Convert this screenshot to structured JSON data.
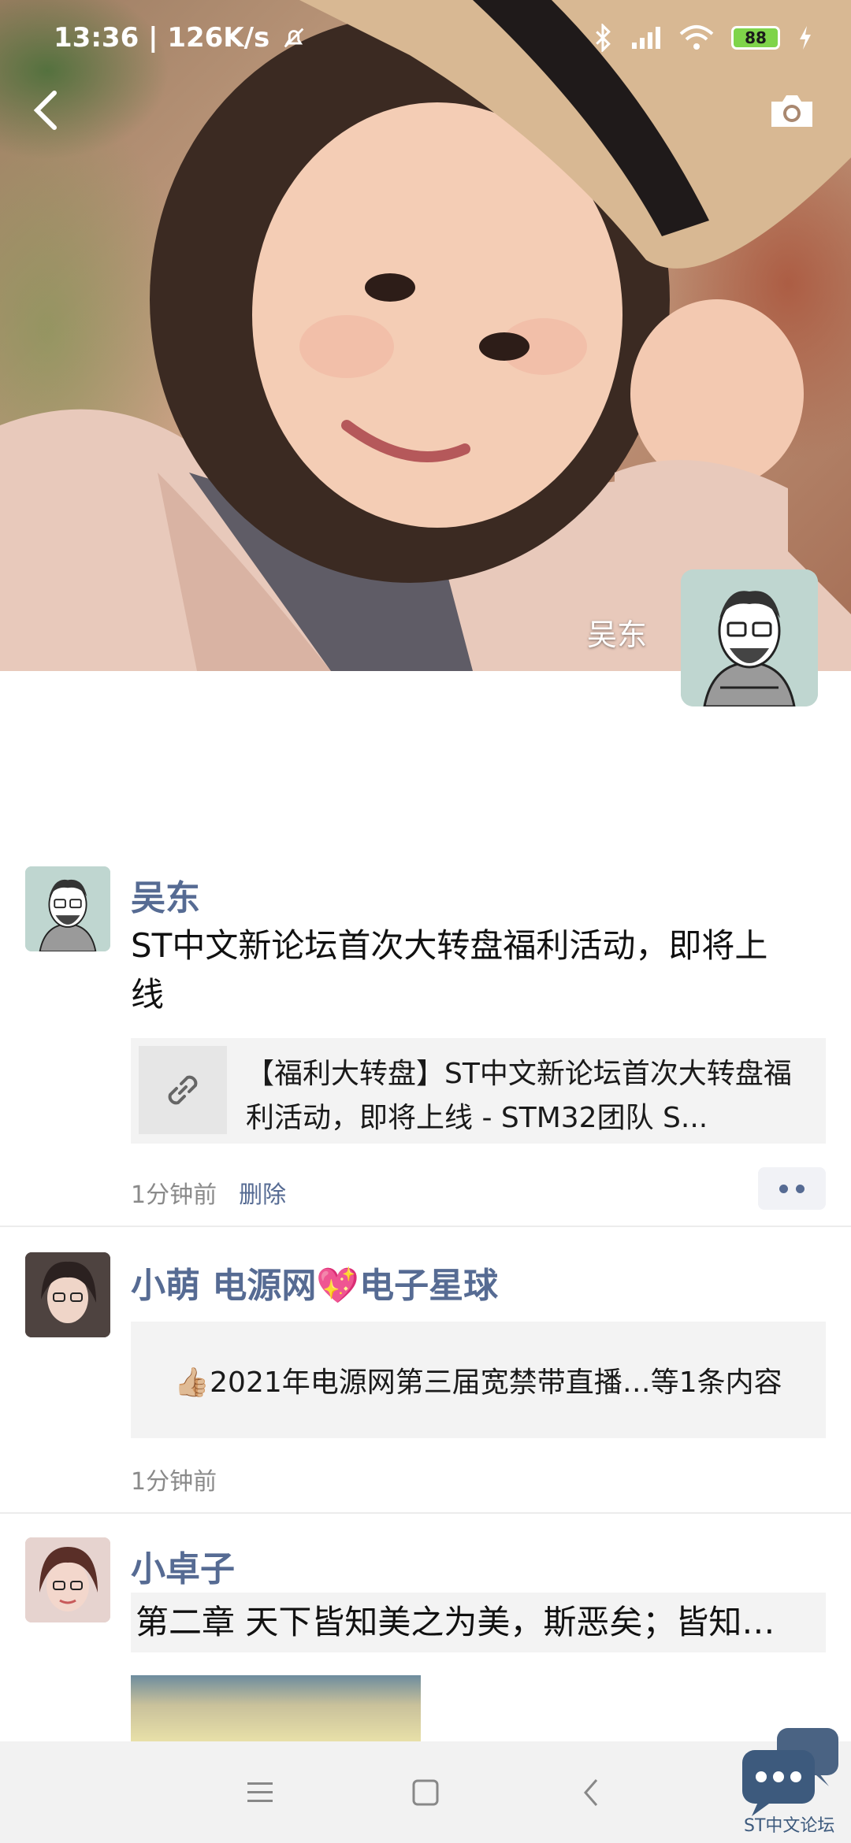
{
  "status_bar": {
    "time_speed": "13:36 | 126K/s",
    "battery": "88",
    "icons": [
      "bell-muted-icon",
      "bluetooth-icon",
      "signal-icon",
      "wifi-icon",
      "battery-icon",
      "charging-icon"
    ]
  },
  "header": {
    "back_icon": "back-chevron-icon",
    "camera_icon": "camera-icon",
    "profile_name": "吴东"
  },
  "posts": [
    {
      "author": "吴东",
      "text": "ST中文新论坛首次大转盘福利活动，即将上线",
      "link_title": "【福利大转盘】ST中文新论坛首次大转盘福利活动，即将上线 - STM32团队 S...",
      "time": "1分钟前",
      "delete_label": "删除"
    },
    {
      "author": "小萌 电源网💖电子星球",
      "share_text": "👍🏼2021年电源网第三届宽禁带直播…等1条内容",
      "time": "1分钟前"
    },
    {
      "author": "小卓子",
      "text": "第二章 天下皆知美之为美，斯恶矣；皆知…"
    }
  ],
  "nav": {
    "menu_icon": "menu-icon",
    "home_icon": "home-square-icon",
    "back_icon": "nav-back-icon"
  },
  "fab": {
    "label": "ST中文论坛",
    "icon": "chat-bubbles-icon"
  },
  "colors": {
    "author_name": "#566b93",
    "card_bg": "#f3f3f3",
    "nav_bg": "#f2f2f2"
  }
}
